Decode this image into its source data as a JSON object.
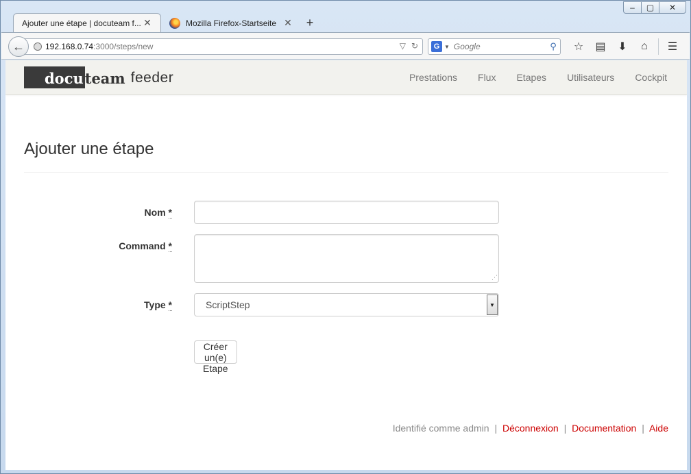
{
  "browser": {
    "tabs": [
      {
        "title": "Ajouter une étape | docuteam f...",
        "active": true
      },
      {
        "title": "Mozilla Firefox-Startseite",
        "active": false
      }
    ],
    "new_tab_label": "+",
    "url_host": "192.168.0.74",
    "url_path": ":3000/steps/new",
    "search_placeholder": "Google",
    "search_engine_icon": "G",
    "window_controls": {
      "minimize": "–",
      "maximize": "▢",
      "close": "✕"
    },
    "icons": [
      "back-icon",
      "globe-icon",
      "dropmarker-icon",
      "reload-icon",
      "search-icon",
      "bookmark-star-icon",
      "reading-list-icon",
      "download-icon",
      "home-icon",
      "menu-icon"
    ]
  },
  "app": {
    "logo": {
      "boxed": "docu",
      "rest": "team",
      "suffix": "feeder"
    },
    "nav": [
      "Prestations",
      "Flux",
      "Etapes",
      "Utilisateurs",
      "Cockpit"
    ]
  },
  "page": {
    "title": "Ajouter une étape",
    "form": {
      "name_label": "Nom",
      "command_label": "Command",
      "type_label": "Type",
      "required_marker": "*",
      "name_value": "",
      "command_value": "",
      "type_value": "ScriptStep",
      "submit_label": "Créer un(e) Etape"
    }
  },
  "footer": {
    "identified_text": "Identifié comme admin",
    "separator": "|",
    "links": [
      "Déconnexion",
      "Documentation",
      "Aide"
    ]
  },
  "colors": {
    "link": "#cc0000",
    "header_bg": "#f2f2ee",
    "logo_box": "#3a3a3a"
  }
}
